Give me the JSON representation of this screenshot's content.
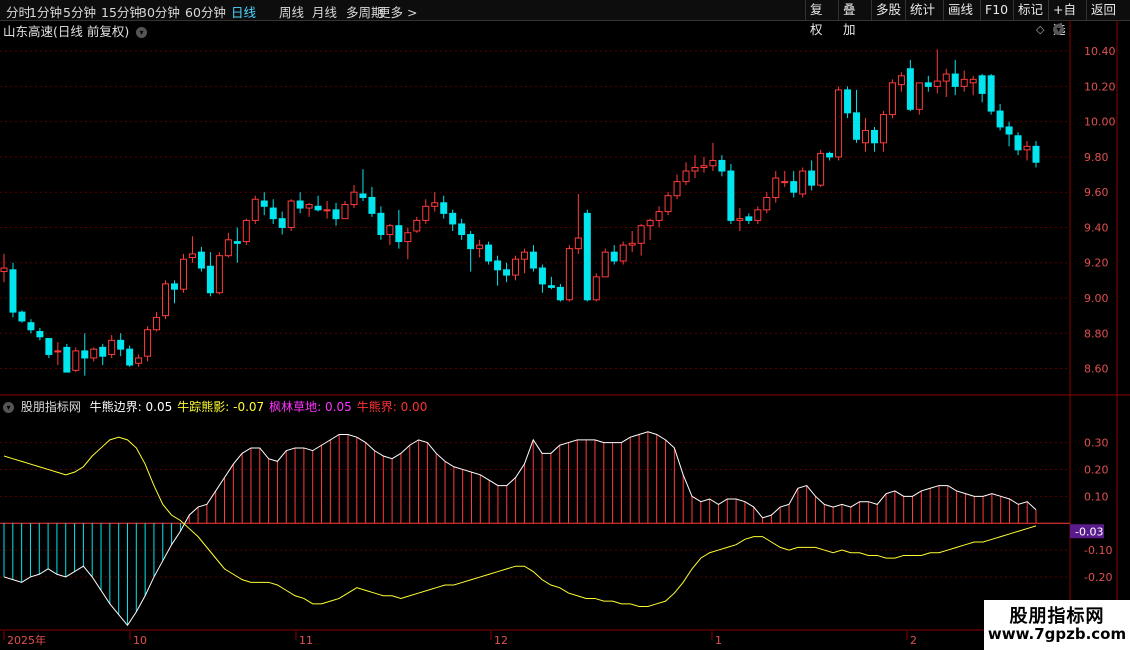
{
  "period_tabs": [
    "分时",
    "1分钟",
    "5分钟",
    "15分钟",
    "30分钟",
    "60分钟",
    "日线",
    "周线",
    "月线",
    "多周期",
    "更多 >"
  ],
  "active_tab": "日线",
  "right_buttons": [
    "复权",
    "叠加",
    "多股",
    "统计",
    "画线",
    "F10",
    "标记",
    "+自选",
    "返回"
  ],
  "stock_title": "山东高速(日线 前复权)",
  "colors": {
    "up": "#ff3b3b",
    "down": "#00e5ee",
    "grid": "#5a0000",
    "axis": "#8b0000",
    "ma": "#ffff33",
    "line": "#ffffff"
  },
  "indicator": {
    "name": "股朋指标网",
    "items": [
      {
        "label": "牛熊边界:",
        "value": "0.05",
        "color": "#ffffff"
      },
      {
        "label": "牛踪熊影:",
        "value": "-0.07",
        "color": "#ffff33"
      },
      {
        "label": "枫林草地:",
        "value": "0.05",
        "color": "#ff33ff"
      },
      {
        "label": "牛熊界:",
        "value": "0.00",
        "color": "#ff3333"
      }
    ],
    "current_value": "-0.03"
  },
  "date_labels": [
    "2025年",
    "10",
    "11",
    "12",
    "1",
    "2"
  ],
  "watermark": {
    "line1": "股朋指标网",
    "line2": "www.7gpzb.com"
  },
  "chart_data": [
    {
      "type": "candlestick",
      "title": "山东高速(日线 前复权)",
      "ylim": [
        8.45,
        10.48
      ],
      "yticks": [
        "10.40",
        "10.20",
        "10.00",
        "9.80",
        "9.60",
        "9.40",
        "9.20",
        "9.00",
        "8.80",
        "8.60"
      ],
      "x_labels": [
        "2025年",
        "10",
        "11",
        "12",
        "1",
        "2"
      ],
      "ohlc": [
        [
          9.15,
          9.25,
          9.09,
          9.17
        ],
        [
          9.16,
          9.2,
          8.89,
          8.92
        ],
        [
          8.92,
          8.93,
          8.86,
          8.87
        ],
        [
          8.86,
          8.88,
          8.8,
          8.82
        ],
        [
          8.81,
          8.83,
          8.76,
          8.78
        ],
        [
          8.77,
          8.77,
          8.66,
          8.68
        ],
        [
          8.7,
          8.75,
          8.62,
          8.7
        ],
        [
          8.72,
          8.74,
          8.58,
          8.58
        ],
        [
          8.59,
          8.72,
          8.58,
          8.7
        ],
        [
          8.7,
          8.8,
          8.56,
          8.66
        ],
        [
          8.66,
          8.72,
          8.64,
          8.71
        ],
        [
          8.72,
          8.74,
          8.62,
          8.67
        ],
        [
          8.68,
          8.79,
          8.66,
          8.76
        ],
        [
          8.76,
          8.8,
          8.67,
          8.71
        ],
        [
          8.71,
          8.73,
          8.61,
          8.62
        ],
        [
          8.63,
          8.68,
          8.61,
          8.66
        ],
        [
          8.67,
          8.84,
          8.64,
          8.82
        ],
        [
          8.82,
          8.92,
          8.81,
          8.89
        ],
        [
          8.9,
          9.1,
          8.88,
          9.08
        ],
        [
          9.08,
          9.1,
          8.97,
          9.05
        ],
        [
          9.05,
          9.25,
          9.03,
          9.22
        ],
        [
          9.23,
          9.35,
          9.2,
          9.25
        ],
        [
          9.26,
          9.29,
          9.15,
          9.17
        ],
        [
          9.18,
          9.26,
          9.01,
          9.03
        ],
        [
          9.03,
          9.26,
          9.02,
          9.24
        ],
        [
          9.24,
          9.37,
          9.23,
          9.33
        ],
        [
          9.32,
          9.4,
          9.2,
          9.31
        ],
        [
          9.32,
          9.45,
          9.3,
          9.44
        ],
        [
          9.44,
          9.58,
          9.42,
          9.56
        ],
        [
          9.55,
          9.6,
          9.47,
          9.52
        ],
        [
          9.51,
          9.56,
          9.42,
          9.45
        ],
        [
          9.45,
          9.49,
          9.36,
          9.4
        ],
        [
          9.4,
          9.56,
          9.38,
          9.55
        ],
        [
          9.55,
          9.6,
          9.48,
          9.51
        ],
        [
          9.51,
          9.54,
          9.46,
          9.53
        ],
        [
          9.52,
          9.58,
          9.49,
          9.5
        ],
        [
          9.5,
          9.55,
          9.45,
          9.5
        ],
        [
          9.5,
          9.54,
          9.41,
          9.45
        ],
        [
          9.45,
          9.55,
          9.45,
          9.53
        ],
        [
          9.53,
          9.64,
          9.51,
          9.6
        ],
        [
          9.59,
          9.73,
          9.55,
          9.57
        ],
        [
          9.57,
          9.63,
          9.46,
          9.48
        ],
        [
          9.48,
          9.52,
          9.33,
          9.36
        ],
        [
          9.36,
          9.42,
          9.3,
          9.41
        ],
        [
          9.41,
          9.5,
          9.28,
          9.32
        ],
        [
          9.32,
          9.4,
          9.22,
          9.37
        ],
        [
          9.38,
          9.46,
          9.37,
          9.44
        ],
        [
          9.44,
          9.56,
          9.42,
          9.52
        ],
        [
          9.52,
          9.6,
          9.49,
          9.54
        ],
        [
          9.54,
          9.58,
          9.45,
          9.48
        ],
        [
          9.48,
          9.5,
          9.38,
          9.42
        ],
        [
          9.42,
          9.45,
          9.33,
          9.36
        ],
        [
          9.36,
          9.38,
          9.15,
          9.28
        ],
        [
          9.28,
          9.33,
          9.23,
          9.3
        ],
        [
          9.3,
          9.32,
          9.19,
          9.21
        ],
        [
          9.21,
          9.24,
          9.07,
          9.16
        ],
        [
          9.16,
          9.2,
          9.09,
          9.13
        ],
        [
          9.13,
          9.24,
          9.1,
          9.22
        ],
        [
          9.22,
          9.28,
          9.14,
          9.26
        ],
        [
          9.26,
          9.3,
          9.15,
          9.17
        ],
        [
          9.17,
          9.19,
          9.03,
          9.08
        ],
        [
          9.07,
          9.12,
          9.05,
          9.06
        ],
        [
          9.06,
          9.08,
          8.98,
          8.99
        ],
        [
          8.99,
          9.3,
          8.98,
          9.28
        ],
        [
          9.28,
          9.59,
          9.25,
          9.34
        ],
        [
          9.48,
          9.5,
          8.98,
          8.99
        ],
        [
          8.99,
          9.14,
          8.98,
          9.12
        ],
        [
          9.12,
          9.28,
          9.12,
          9.26
        ],
        [
          9.26,
          9.3,
          9.19,
          9.21
        ],
        [
          9.21,
          9.32,
          9.19,
          9.3
        ],
        [
          9.3,
          9.38,
          9.26,
          9.31
        ],
        [
          9.31,
          9.42,
          9.24,
          9.41
        ],
        [
          9.41,
          9.45,
          9.33,
          9.44
        ],
        [
          9.44,
          9.52,
          9.4,
          9.49
        ],
        [
          9.49,
          9.6,
          9.47,
          9.58
        ],
        [
          9.58,
          9.7,
          9.56,
          9.66
        ],
        [
          9.66,
          9.77,
          9.64,
          9.72
        ],
        [
          9.72,
          9.81,
          9.68,
          9.74
        ],
        [
          9.74,
          9.8,
          9.71,
          9.75
        ],
        [
          9.75,
          9.88,
          9.72,
          9.78
        ],
        [
          9.78,
          9.81,
          9.69,
          9.72
        ],
        [
          9.72,
          9.76,
          9.42,
          9.44
        ],
        [
          9.44,
          9.51,
          9.38,
          9.45
        ],
        [
          9.46,
          9.48,
          9.42,
          9.44
        ],
        [
          9.44,
          9.52,
          9.42,
          9.5
        ],
        [
          9.5,
          9.6,
          9.48,
          9.57
        ],
        [
          9.57,
          9.72,
          9.54,
          9.68
        ],
        [
          9.66,
          9.72,
          9.63,
          9.66
        ],
        [
          9.66,
          9.72,
          9.57,
          9.6
        ],
        [
          9.59,
          9.74,
          9.57,
          9.72
        ],
        [
          9.72,
          9.78,
          9.61,
          9.64
        ],
        [
          9.64,
          9.84,
          9.63,
          9.82
        ],
        [
          9.82,
          9.83,
          9.78,
          9.8
        ],
        [
          9.8,
          10.2,
          9.78,
          10.18
        ],
        [
          10.18,
          10.2,
          10.02,
          10.05
        ],
        [
          10.05,
          10.18,
          9.88,
          9.9
        ],
        [
          9.88,
          10.02,
          9.83,
          9.95
        ],
        [
          9.95,
          9.97,
          9.83,
          9.88
        ],
        [
          9.88,
          10.06,
          9.83,
          10.04
        ],
        [
          10.04,
          10.24,
          10.02,
          10.22
        ],
        [
          10.21,
          10.28,
          10.17,
          10.26
        ],
        [
          10.3,
          10.35,
          10.06,
          10.07
        ],
        [
          10.07,
          10.22,
          10.04,
          10.22
        ],
        [
          10.22,
          10.26,
          10.17,
          10.2
        ],
        [
          10.2,
          10.41,
          10.16,
          10.23
        ],
        [
          10.23,
          10.3,
          10.14,
          10.27
        ],
        [
          10.27,
          10.35,
          10.15,
          10.2
        ],
        [
          10.2,
          10.29,
          10.17,
          10.24
        ],
        [
          10.22,
          10.26,
          10.15,
          10.24
        ],
        [
          10.26,
          10.27,
          10.11,
          10.16
        ],
        [
          10.26,
          10.27,
          10.04,
          10.06
        ],
        [
          10.06,
          10.1,
          9.95,
          9.97
        ],
        [
          9.97,
          10.0,
          9.86,
          9.93
        ],
        [
          9.92,
          9.94,
          9.81,
          9.84
        ],
        [
          9.84,
          9.89,
          9.78,
          9.86
        ],
        [
          9.86,
          9.89,
          9.74,
          9.77
        ]
      ]
    },
    {
      "type": "bar+line",
      "title": "股朋指标网",
      "ylim": [
        -0.39,
        0.41
      ],
      "yticks": [
        "0.30",
        "0.20",
        "0.10",
        "-0.10",
        "-0.20"
      ],
      "series": [
        {
          "name": "牛熊边界",
          "kind": "bar_with_line",
          "values": [
            -0.2,
            -0.21,
            -0.22,
            -0.2,
            -0.19,
            -0.17,
            -0.19,
            -0.2,
            -0.18,
            -0.16,
            -0.2,
            -0.25,
            -0.3,
            -0.34,
            -0.38,
            -0.33,
            -0.27,
            -0.2,
            -0.14,
            -0.08,
            -0.03,
            0.03,
            0.06,
            0.07,
            0.12,
            0.17,
            0.22,
            0.26,
            0.28,
            0.28,
            0.24,
            0.23,
            0.27,
            0.28,
            0.28,
            0.27,
            0.29,
            0.31,
            0.33,
            0.33,
            0.32,
            0.3,
            0.27,
            0.25,
            0.24,
            0.26,
            0.29,
            0.31,
            0.3,
            0.26,
            0.23,
            0.21,
            0.2,
            0.19,
            0.18,
            0.16,
            0.14,
            0.14,
            0.17,
            0.22,
            0.31,
            0.26,
            0.26,
            0.29,
            0.3,
            0.31,
            0.31,
            0.31,
            0.3,
            0.3,
            0.3,
            0.32,
            0.33,
            0.34,
            0.33,
            0.31,
            0.28,
            0.18,
            0.1,
            0.08,
            0.09,
            0.07,
            0.09,
            0.09,
            0.08,
            0.06,
            0.02,
            0.03,
            0.06,
            0.07,
            0.13,
            0.14,
            0.1,
            0.07,
            0.06,
            0.07,
            0.06,
            0.08,
            0.08,
            0.07,
            0.11,
            0.12,
            0.1,
            0.1,
            0.12,
            0.13,
            0.14,
            0.14,
            0.12,
            0.11,
            0.1,
            0.1,
            0.11,
            0.1,
            0.09,
            0.07,
            0.08,
            0.05
          ]
        },
        {
          "name": "牛踪熊影",
          "kind": "line",
          "values": [
            0.25,
            0.24,
            0.23,
            0.22,
            0.21,
            0.2,
            0.19,
            0.18,
            0.19,
            0.21,
            0.25,
            0.28,
            0.31,
            0.32,
            0.31,
            0.28,
            0.22,
            0.14,
            0.07,
            0.03,
            0.01,
            -0.02,
            -0.05,
            -0.09,
            -0.13,
            -0.17,
            -0.19,
            -0.21,
            -0.22,
            -0.22,
            -0.22,
            -0.23,
            -0.25,
            -0.27,
            -0.28,
            -0.3,
            -0.3,
            -0.29,
            -0.28,
            -0.26,
            -0.24,
            -0.25,
            -0.26,
            -0.27,
            -0.27,
            -0.28,
            -0.27,
            -0.26,
            -0.25,
            -0.24,
            -0.23,
            -0.23,
            -0.22,
            -0.21,
            -0.2,
            -0.19,
            -0.18,
            -0.17,
            -0.16,
            -0.16,
            -0.18,
            -0.21,
            -0.23,
            -0.24,
            -0.26,
            -0.27,
            -0.28,
            -0.28,
            -0.29,
            -0.29,
            -0.3,
            -0.3,
            -0.31,
            -0.31,
            -0.3,
            -0.29,
            -0.26,
            -0.22,
            -0.17,
            -0.13,
            -0.11,
            -0.1,
            -0.09,
            -0.08,
            -0.06,
            -0.05,
            -0.05,
            -0.07,
            -0.09,
            -0.1,
            -0.09,
            -0.09,
            -0.09,
            -0.1,
            -0.11,
            -0.1,
            -0.11,
            -0.11,
            -0.12,
            -0.12,
            -0.13,
            -0.13,
            -0.12,
            -0.12,
            -0.12,
            -0.11,
            -0.11,
            -0.1,
            -0.09,
            -0.08,
            -0.07,
            -0.07,
            -0.06,
            -0.05,
            -0.04,
            -0.03,
            -0.02,
            -0.01
          ]
        }
      ]
    }
  ]
}
